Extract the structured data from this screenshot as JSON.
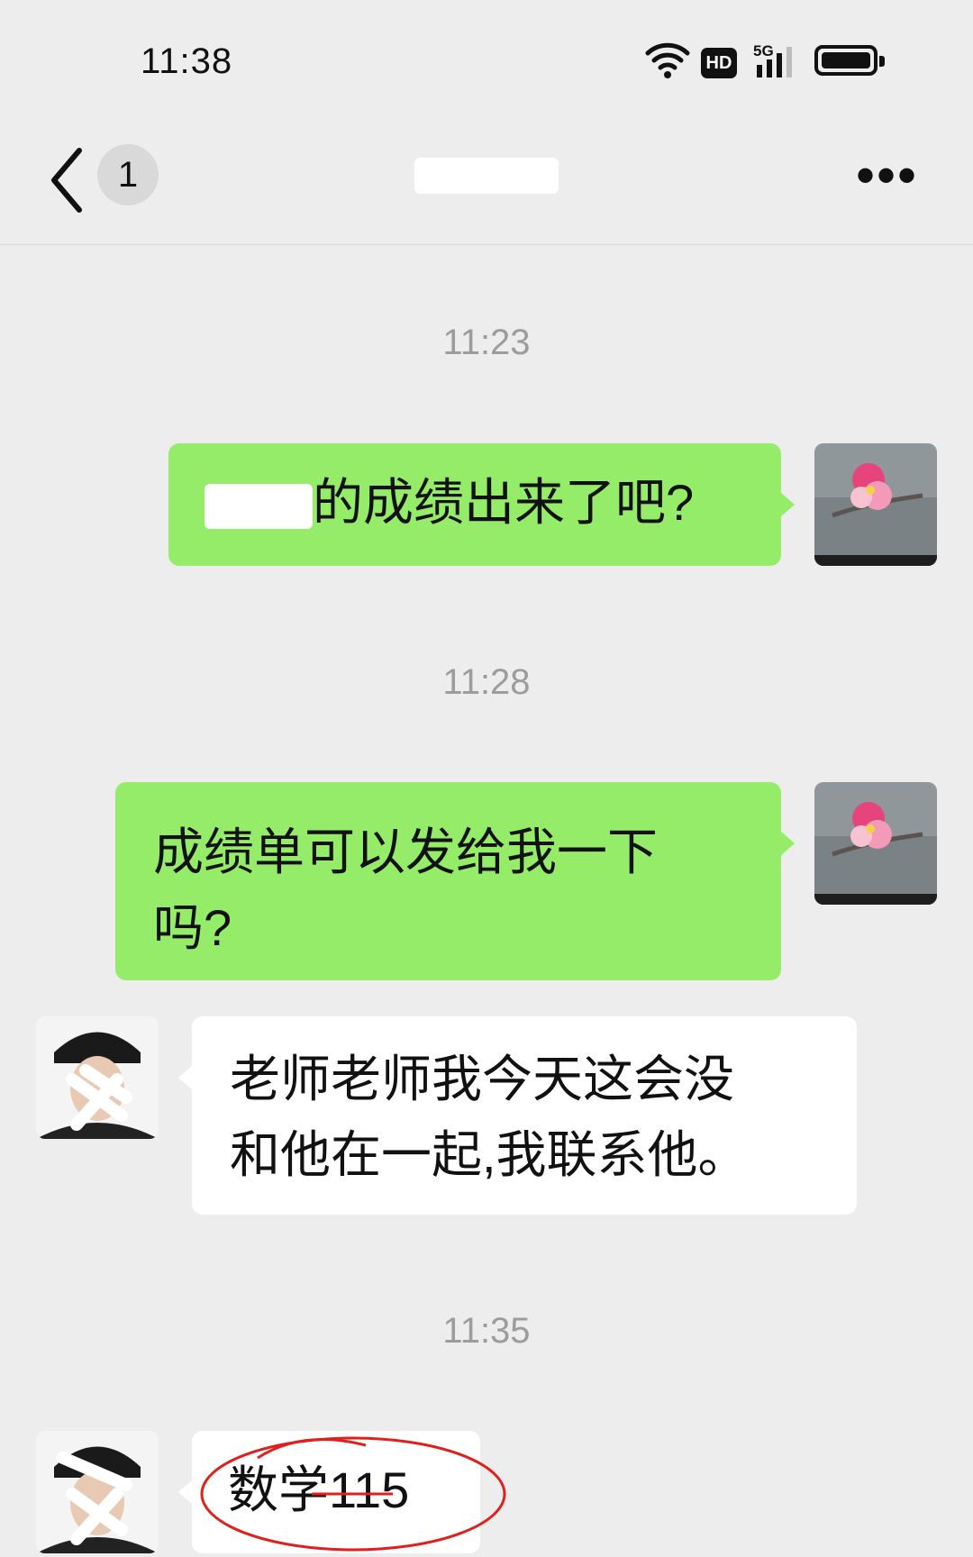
{
  "status_bar": {
    "time": "11:38",
    "network_badge": "HD",
    "signal_label": "5G"
  },
  "nav": {
    "unread_count": "1",
    "chat_title": "",
    "more_label": "•••"
  },
  "messages": [
    {
      "type": "timestamp",
      "text": "11:23"
    },
    {
      "type": "outgoing",
      "redacted_prefix": true,
      "text": "的成绩出来了吧?"
    },
    {
      "type": "timestamp",
      "text": "11:28"
    },
    {
      "type": "outgoing",
      "text": "成绩单可以发给我一下吗?",
      "line1": "成绩单可以发给我一下",
      "line2": "吗?"
    },
    {
      "type": "incoming",
      "line1": "老师老师我今天这会没",
      "line2": "和他在一起,我联系他。"
    },
    {
      "type": "timestamp",
      "text": "11:35"
    },
    {
      "type": "incoming",
      "text": "数学115",
      "annotation": "red-circle"
    }
  ],
  "colors": {
    "outgoing_bubble": "#95ec69",
    "incoming_bubble": "#ffffff",
    "background": "#ededed",
    "annotation": "#e0201c"
  },
  "icons": [
    "back-arrow-icon",
    "wifi-icon",
    "signal-icon",
    "battery-icon",
    "more-icon"
  ]
}
